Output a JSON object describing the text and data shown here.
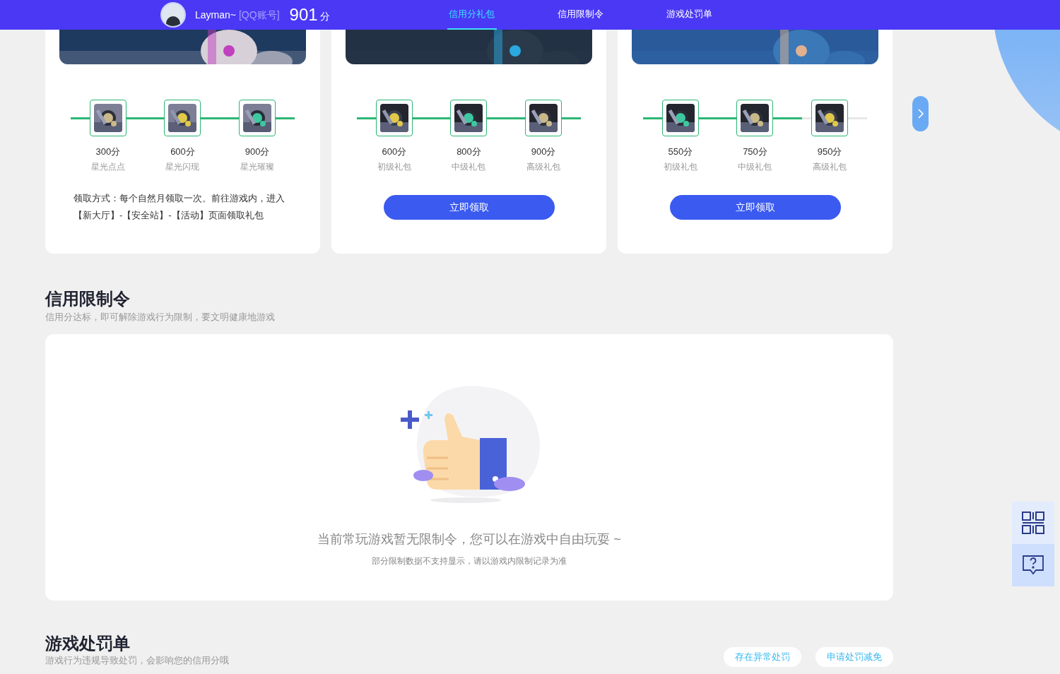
{
  "header": {
    "user_name": "Layman~",
    "account_type": "[QQ账号]",
    "score": "901",
    "score_unit": "分",
    "tabs": [
      {
        "label": "信用分礼包",
        "selected": true
      },
      {
        "label": "信用限制令",
        "selected": false
      },
      {
        "label": "游戏处罚单",
        "selected": false
      }
    ]
  },
  "gift_cards": [
    {
      "level": 1,
      "rewards": [
        {
          "points": "300分",
          "name": "星光点点"
        },
        {
          "points": "600分",
          "name": "星光闪现"
        },
        {
          "points": "900分",
          "name": "星光璀璨"
        }
      ],
      "kind": "note",
      "note": "领取方式：每个自然月领取一次。前往游戏内，进入【新大厅】-【安全站】-【活动】页面领取礼包"
    },
    {
      "level": 1,
      "rewards": [
        {
          "points": "600分",
          "name": "初级礼包"
        },
        {
          "points": "800分",
          "name": "中级礼包"
        },
        {
          "points": "900分",
          "name": "高级礼包"
        }
      ],
      "kind": "button",
      "button": "立即领取"
    },
    {
      "level": 0.71,
      "rewards": [
        {
          "points": "550分",
          "name": "初级礼包"
        },
        {
          "points": "750分",
          "name": "中级礼包"
        },
        {
          "points": "950分",
          "name": "高级礼包"
        }
      ],
      "kind": "button",
      "button": "立即领取"
    }
  ],
  "restriction": {
    "title": "信用限制令",
    "subtitle": "信用分达标，即可解除游戏行为限制，要文明健康地游戏",
    "empty_message": "当前常玩游戏暂无限制令，您可以在游戏中自由玩耍 ~",
    "empty_note": "部分限制数据不支持显示，请以游戏内限制记录为准"
  },
  "penalty": {
    "title": "游戏处罚单",
    "subtitle": "游戏行为违规导致处罚，会影响您的信用分哦",
    "buttons": [
      "存在异常处罚",
      "申请处罚减免"
    ]
  }
}
